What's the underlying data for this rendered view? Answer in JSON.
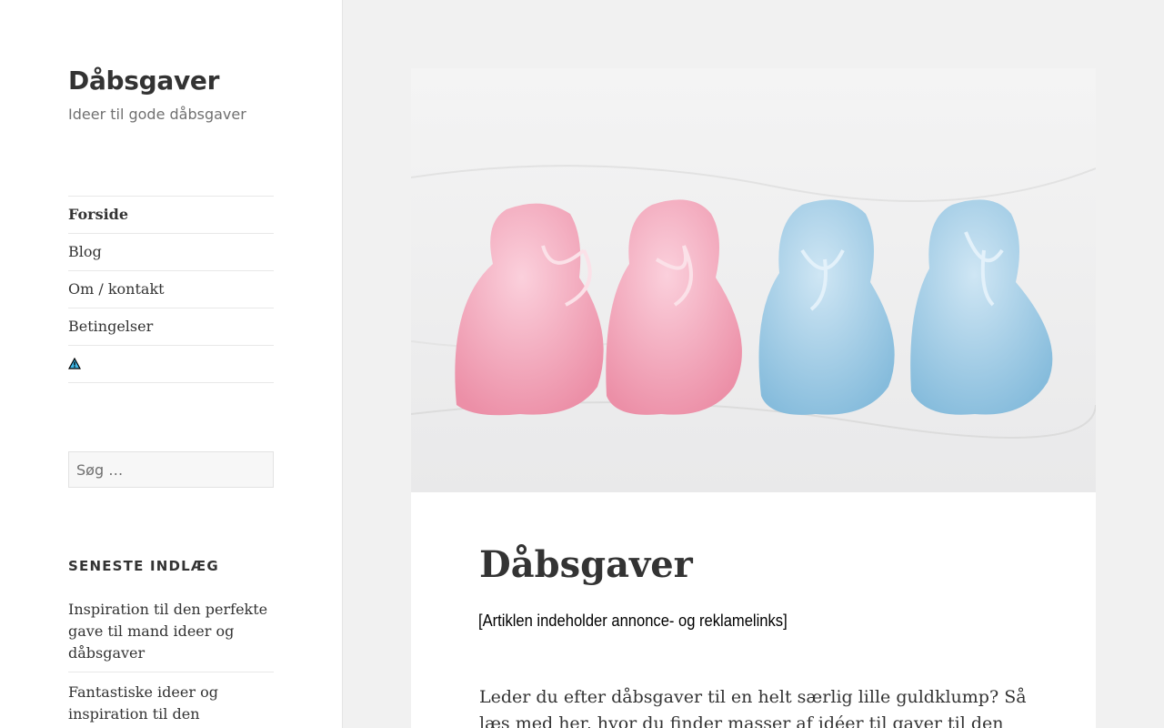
{
  "site": {
    "title": "Dåbsgaver",
    "description": "Ideer til gode dåbsgaver"
  },
  "nav": {
    "items": [
      {
        "label": "Forside",
        "active": true
      },
      {
        "label": "Blog",
        "active": false
      },
      {
        "label": "Om / kontakt",
        "active": false
      },
      {
        "label": "Betingelser",
        "active": false
      }
    ],
    "icon": "warning-icon"
  },
  "search": {
    "placeholder": "Søg …"
  },
  "recent_posts": {
    "heading": "SENESTE INDLÆG",
    "items": [
      "Inspiration til den perfekte gave til mand ideer og dåbsgaver",
      "Fantastiske ideer og inspiration til den personlige"
    ]
  },
  "article": {
    "image_alt": "baby-booties-image",
    "title": "Dåbsgaver",
    "disclaimer": "[Artiklen indeholder annonce- og reklamelinks]",
    "intro": "Leder du efter dåbsgaver til en helt særlig lille guldklump? Så læs med her, hvor du finder masser af idéer til gaver til den store dag"
  },
  "colors": {
    "background": "#f1f1f1",
    "sidebar": "#ffffff",
    "text": "#333333",
    "muted": "#707070"
  }
}
